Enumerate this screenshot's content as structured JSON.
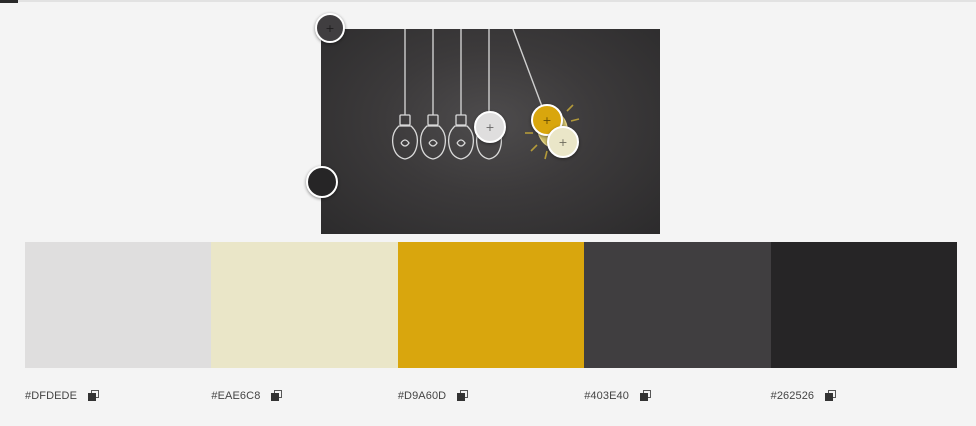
{
  "palette": {
    "colors": [
      {
        "hex": "#DFDEDE"
      },
      {
        "hex": "#EAE6C8"
      },
      {
        "hex": "#D9A60D"
      },
      {
        "hex": "#403E40"
      },
      {
        "hex": "#262526"
      }
    ]
  },
  "image": {
    "description_icon": "lightbulb-newtons-cradle-photo"
  },
  "pickers": [
    {
      "color": "#403E40",
      "icon": "plus-icon"
    },
    {
      "color": "#262526",
      "icon": "plus-icon"
    },
    {
      "color": "#DFDEDE",
      "icon": "plus-icon"
    },
    {
      "color": "#D9A60D",
      "icon": "plus-icon"
    },
    {
      "color": "#EAE6C8",
      "icon": "plus-icon"
    }
  ]
}
